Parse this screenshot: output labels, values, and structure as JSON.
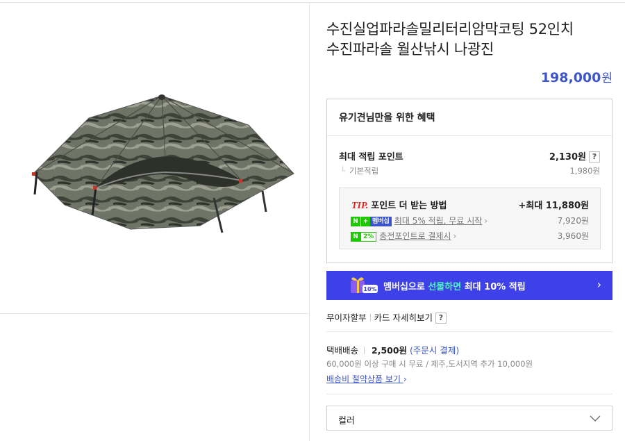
{
  "product": {
    "title_line1": "수진실업파라솔밀리터리암막코팅 52인치",
    "title_line2": "수진파라솔 월산낚시 나광진",
    "price": "198,000",
    "currency": "원"
  },
  "benefit": {
    "header": "유기견님만을 위한 혜택",
    "max_point_label": "최대 적립 포인트",
    "max_point_value": "2,130원",
    "help_icon": "?",
    "basic_label": "기본적립",
    "basic_value": "1,980원",
    "tip": {
      "tip_word": "TIP.",
      "title": "포인트 더 받는 방법",
      "max": "+최대 11,880원",
      "rows": [
        {
          "badge": "N+멤버십",
          "label": "최대 5% 적립, 무료 시작",
          "value": "7,920원"
        },
        {
          "badge": "N2%",
          "label": "충전포인트로 결제시",
          "value": "3,960원"
        }
      ]
    }
  },
  "banner": {
    "prefix": "멤버십으로 ",
    "highlight": "선물하면",
    "suffix": " 최대 10% 적립",
    "gift_badge": "10%"
  },
  "links": {
    "installment": "무이자할부",
    "card_detail": "카드 자세히보기",
    "help": "?"
  },
  "shipping": {
    "method": "택배배송",
    "fee": "2,500원",
    "pay_note": "(주문시 결제)",
    "note": "60,000원 이상 구매 시 무료 / 제주,도서지역 추가 10,000원",
    "saver_link": "배송비 절약상품 보기"
  },
  "option": {
    "label": "컬러"
  },
  "colors": {
    "price_blue": "#3c55c8",
    "banner_bg": "#3e40e8",
    "naver_green": "#1ec800",
    "tip_red": "#e0231f"
  }
}
